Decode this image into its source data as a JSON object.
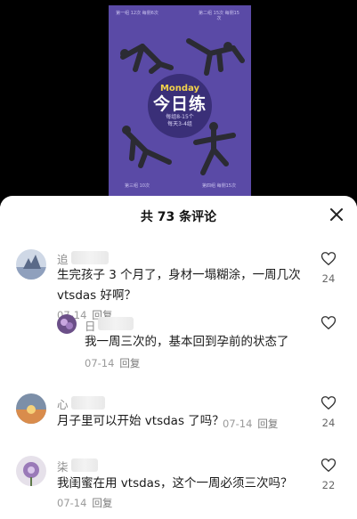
{
  "poster": {
    "top_captions": [
      "第一组 12次 每侧6次",
      "第二组 15次 每侧15次"
    ],
    "bottom_captions": [
      "第三组 10次",
      "第四组 每侧15次"
    ],
    "badge_en": "Monday",
    "badge_title": "今日练",
    "badge_sub1": "每组8-15个",
    "badge_sub2": "每天3-4组",
    "colors": {
      "background": "#5a4aa6",
      "badge": "#3a2f78",
      "accent": "#f2d24a"
    }
  },
  "sheet": {
    "title": "共 73 条评论",
    "close_icon": "close-icon"
  },
  "comments": [
    {
      "name": "追",
      "lines": [
        "生完孩子 3 个月了，身材一塌糊涂，一周几次",
        "vtsdas 好啊？"
      ],
      "date": "07-14",
      "reply_label": "回复",
      "likes": "24"
    },
    {
      "name": "日",
      "lines": [
        "我一周三次的，基本回到孕前的状态了"
      ],
      "date": "07-14",
      "reply_label": "回复",
      "likes": ""
    },
    {
      "name": "心",
      "lines": [
        "月子里可以开始 vtsdas 了吗？"
      ],
      "date": "07-14",
      "reply_label": "回复",
      "likes": "24"
    },
    {
      "name": "柒",
      "lines": [
        "我闺蜜在用 vtsdas，这个一周必须三次吗？"
      ],
      "date": "07-14",
      "reply_label": "回复",
      "likes": "22"
    }
  ]
}
